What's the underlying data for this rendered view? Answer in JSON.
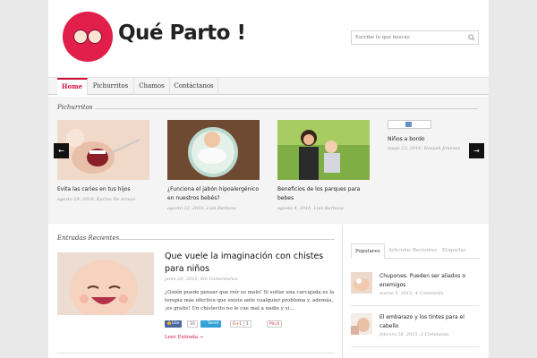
{
  "site": {
    "logo_text": "Qué Parto !",
    "search_placeholder": "Escribe lo que buscas"
  },
  "nav": {
    "items": [
      {
        "label": "Home",
        "active": true
      },
      {
        "label": "Pichurritos",
        "active": false
      },
      {
        "label": "Chamos",
        "active": false
      },
      {
        "label": "Contáctanos",
        "active": false
      }
    ]
  },
  "slider": {
    "title": "Pichurritos",
    "prev_label": "←",
    "next_label": "→",
    "slides": [
      {
        "title": "Evita las caries en tus hijos",
        "date": "agosto 29, 2016,",
        "author": "Karina De Armas"
      },
      {
        "title": "¿Funciona el jabón hipoalergénico en nuestros bebés?",
        "date": "agosto 22, 2016,",
        "author": "Luis Barboza"
      },
      {
        "title": "Beneficios de los parques para bebes",
        "date": "agosto 4, 2016,",
        "author": "Luis Barboza"
      },
      {
        "title": "Niños a bordo",
        "date": "mayo 23, 2016,",
        "author": "Nasyah Jimenez"
      }
    ]
  },
  "recent": {
    "title": "Entradas Recientes",
    "post": {
      "title": "Que vuele la imaginación con chistes para niños",
      "date": "junio 20, 2015,",
      "comments": "Sin Comentarios",
      "excerpt": "¿Quién puede pensar que reír es malo! Si soltar una carcajada es la terapia más efectiva que existe ante cualquier problema y, además, ¡es gratis! Un chistecito no le cae mal a nadie y si…",
      "share": {
        "like": "Like",
        "like_count": "10",
        "tweet": "Tweet",
        "gplus": "G+1",
        "gplus_count": "1",
        "pin": "Pin it"
      },
      "read_more": "Leer Entrada →"
    }
  },
  "sidebar": {
    "tabs": [
      "Populares",
      "Artículos Recientes",
      "Etiquetas"
    ],
    "items": [
      {
        "title": "Chupones. Pueden ser aliados o enemigos",
        "date": "marzo 5, 2015,",
        "comments": "4 Comments"
      },
      {
        "title": "El embarazo y los tintes para el cabello",
        "date": "febrero 26, 2015,",
        "comments": "2 Comments"
      }
    ]
  },
  "colors": {
    "accent": "#d0103a",
    "logo": "#e11f4a"
  }
}
